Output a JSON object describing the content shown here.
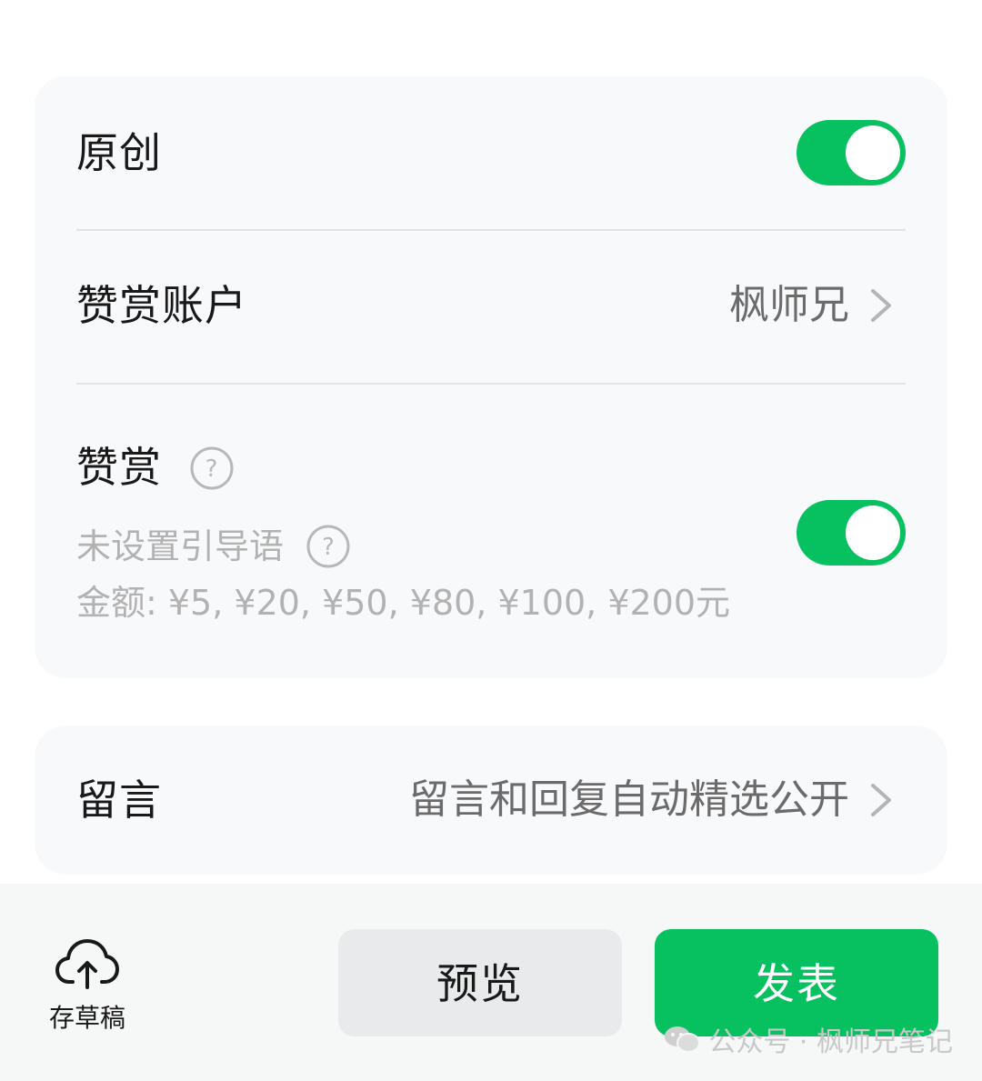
{
  "settings": {
    "original": {
      "label": "原创",
      "enabled": true
    },
    "reward_account": {
      "label": "赞赏账户",
      "value": "枫师兄"
    },
    "reward": {
      "label": "赞赏",
      "enabled": true,
      "guide_text": "未设置引导语",
      "amounts": "金额: ¥5, ¥20, ¥50, ¥80, ¥100, ¥200元"
    },
    "comments": {
      "label": "留言",
      "value": "留言和回复自动精选公开"
    }
  },
  "bottom": {
    "draft_label": "存草稿",
    "preview_label": "预览",
    "publish_label": "发表"
  },
  "watermark": "公众号 · 枫师兄笔记",
  "colors": {
    "accent": "#07c160",
    "card_bg": "#f8f9fb",
    "bar_bg": "#f6f7f7"
  }
}
